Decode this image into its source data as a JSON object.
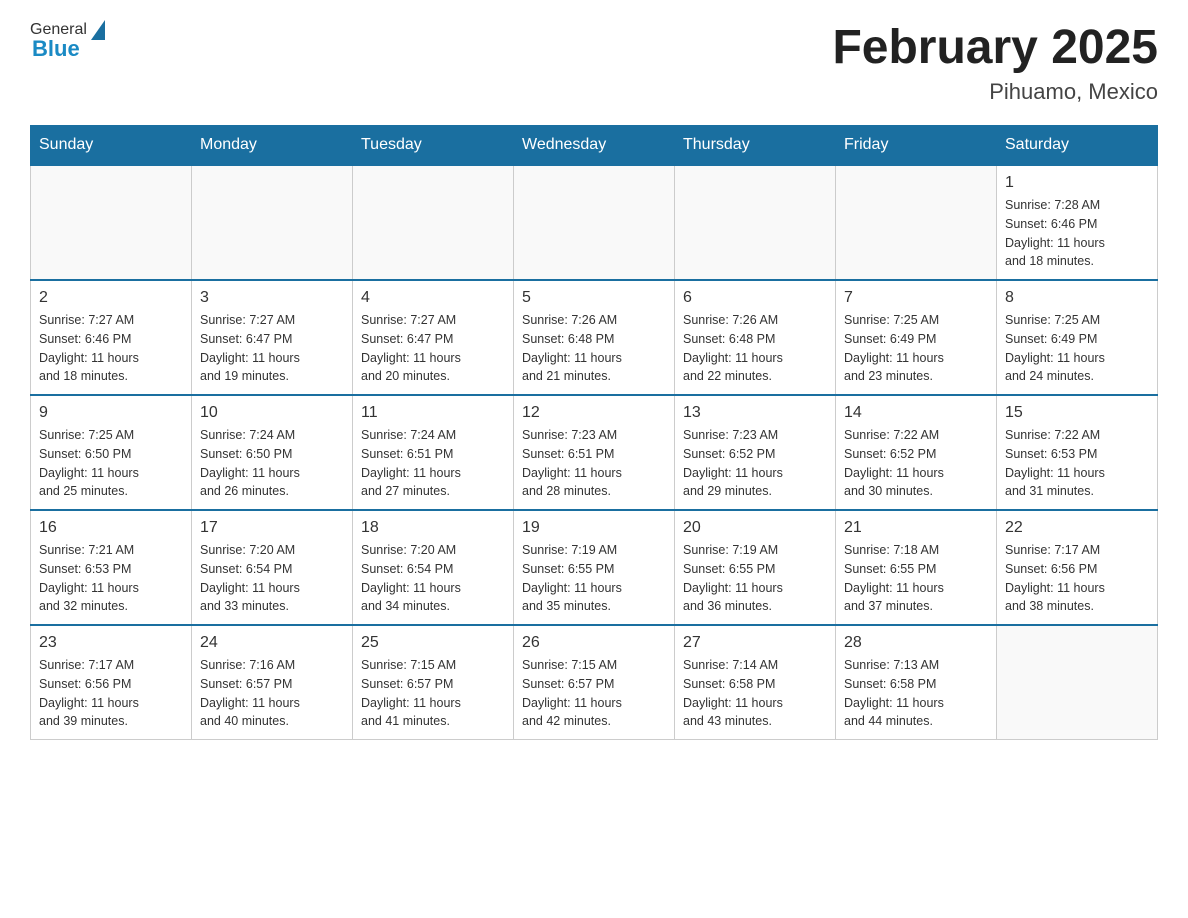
{
  "header": {
    "logo_general": "General",
    "logo_blue": "Blue",
    "month_title": "February 2025",
    "location": "Pihuamo, Mexico"
  },
  "days_of_week": [
    "Sunday",
    "Monday",
    "Tuesday",
    "Wednesday",
    "Thursday",
    "Friday",
    "Saturday"
  ],
  "weeks": [
    [
      {
        "day": "",
        "info": ""
      },
      {
        "day": "",
        "info": ""
      },
      {
        "day": "",
        "info": ""
      },
      {
        "day": "",
        "info": ""
      },
      {
        "day": "",
        "info": ""
      },
      {
        "day": "",
        "info": ""
      },
      {
        "day": "1",
        "info": "Sunrise: 7:28 AM\nSunset: 6:46 PM\nDaylight: 11 hours\nand 18 minutes."
      }
    ],
    [
      {
        "day": "2",
        "info": "Sunrise: 7:27 AM\nSunset: 6:46 PM\nDaylight: 11 hours\nand 18 minutes."
      },
      {
        "day": "3",
        "info": "Sunrise: 7:27 AM\nSunset: 6:47 PM\nDaylight: 11 hours\nand 19 minutes."
      },
      {
        "day": "4",
        "info": "Sunrise: 7:27 AM\nSunset: 6:47 PM\nDaylight: 11 hours\nand 20 minutes."
      },
      {
        "day": "5",
        "info": "Sunrise: 7:26 AM\nSunset: 6:48 PM\nDaylight: 11 hours\nand 21 minutes."
      },
      {
        "day": "6",
        "info": "Sunrise: 7:26 AM\nSunset: 6:48 PM\nDaylight: 11 hours\nand 22 minutes."
      },
      {
        "day": "7",
        "info": "Sunrise: 7:25 AM\nSunset: 6:49 PM\nDaylight: 11 hours\nand 23 minutes."
      },
      {
        "day": "8",
        "info": "Sunrise: 7:25 AM\nSunset: 6:49 PM\nDaylight: 11 hours\nand 24 minutes."
      }
    ],
    [
      {
        "day": "9",
        "info": "Sunrise: 7:25 AM\nSunset: 6:50 PM\nDaylight: 11 hours\nand 25 minutes."
      },
      {
        "day": "10",
        "info": "Sunrise: 7:24 AM\nSunset: 6:50 PM\nDaylight: 11 hours\nand 26 minutes."
      },
      {
        "day": "11",
        "info": "Sunrise: 7:24 AM\nSunset: 6:51 PM\nDaylight: 11 hours\nand 27 minutes."
      },
      {
        "day": "12",
        "info": "Sunrise: 7:23 AM\nSunset: 6:51 PM\nDaylight: 11 hours\nand 28 minutes."
      },
      {
        "day": "13",
        "info": "Sunrise: 7:23 AM\nSunset: 6:52 PM\nDaylight: 11 hours\nand 29 minutes."
      },
      {
        "day": "14",
        "info": "Sunrise: 7:22 AM\nSunset: 6:52 PM\nDaylight: 11 hours\nand 30 minutes."
      },
      {
        "day": "15",
        "info": "Sunrise: 7:22 AM\nSunset: 6:53 PM\nDaylight: 11 hours\nand 31 minutes."
      }
    ],
    [
      {
        "day": "16",
        "info": "Sunrise: 7:21 AM\nSunset: 6:53 PM\nDaylight: 11 hours\nand 32 minutes."
      },
      {
        "day": "17",
        "info": "Sunrise: 7:20 AM\nSunset: 6:54 PM\nDaylight: 11 hours\nand 33 minutes."
      },
      {
        "day": "18",
        "info": "Sunrise: 7:20 AM\nSunset: 6:54 PM\nDaylight: 11 hours\nand 34 minutes."
      },
      {
        "day": "19",
        "info": "Sunrise: 7:19 AM\nSunset: 6:55 PM\nDaylight: 11 hours\nand 35 minutes."
      },
      {
        "day": "20",
        "info": "Sunrise: 7:19 AM\nSunset: 6:55 PM\nDaylight: 11 hours\nand 36 minutes."
      },
      {
        "day": "21",
        "info": "Sunrise: 7:18 AM\nSunset: 6:55 PM\nDaylight: 11 hours\nand 37 minutes."
      },
      {
        "day": "22",
        "info": "Sunrise: 7:17 AM\nSunset: 6:56 PM\nDaylight: 11 hours\nand 38 minutes."
      }
    ],
    [
      {
        "day": "23",
        "info": "Sunrise: 7:17 AM\nSunset: 6:56 PM\nDaylight: 11 hours\nand 39 minutes."
      },
      {
        "day": "24",
        "info": "Sunrise: 7:16 AM\nSunset: 6:57 PM\nDaylight: 11 hours\nand 40 minutes."
      },
      {
        "day": "25",
        "info": "Sunrise: 7:15 AM\nSunset: 6:57 PM\nDaylight: 11 hours\nand 41 minutes."
      },
      {
        "day": "26",
        "info": "Sunrise: 7:15 AM\nSunset: 6:57 PM\nDaylight: 11 hours\nand 42 minutes."
      },
      {
        "day": "27",
        "info": "Sunrise: 7:14 AM\nSunset: 6:58 PM\nDaylight: 11 hours\nand 43 minutes."
      },
      {
        "day": "28",
        "info": "Sunrise: 7:13 AM\nSunset: 6:58 PM\nDaylight: 11 hours\nand 44 minutes."
      },
      {
        "day": "",
        "info": ""
      }
    ]
  ]
}
